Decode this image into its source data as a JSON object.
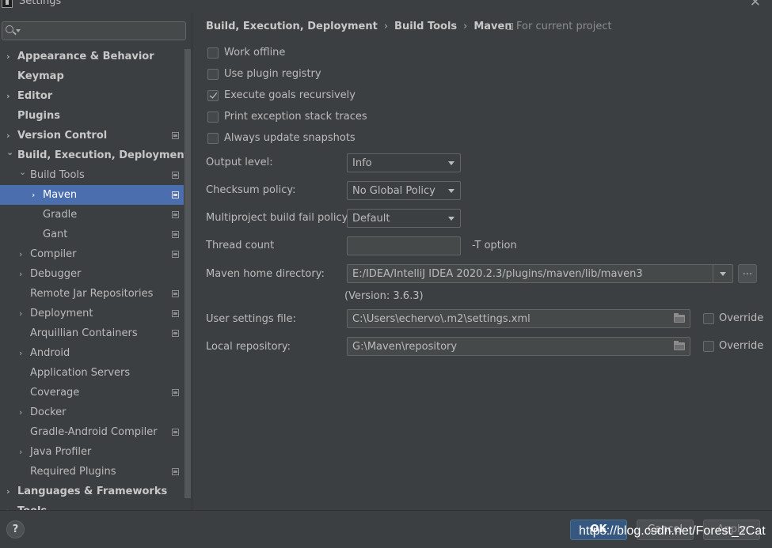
{
  "window": {
    "title": "Settings"
  },
  "sidebar": {
    "search": {
      "value": ""
    },
    "items": [
      {
        "label": "Appearance & Behavior",
        "expandable": true,
        "bold": true,
        "level": 0,
        "project": false
      },
      {
        "label": "Keymap",
        "expandable": false,
        "bold": true,
        "level": 0,
        "project": false
      },
      {
        "label": "Editor",
        "expandable": true,
        "bold": true,
        "level": 0,
        "project": false
      },
      {
        "label": "Plugins",
        "expandable": false,
        "bold": true,
        "level": 0,
        "project": false
      },
      {
        "label": "Version Control",
        "expandable": true,
        "bold": true,
        "level": 0,
        "project": true
      },
      {
        "label": "Build, Execution, Deployment",
        "expandable": true,
        "expanded": true,
        "bold": true,
        "level": 0,
        "project": false
      },
      {
        "label": "Build Tools",
        "expandable": true,
        "expanded": true,
        "bold": false,
        "level": 1,
        "project": true
      },
      {
        "label": "Maven",
        "expandable": true,
        "bold": false,
        "level": 2,
        "project": true,
        "selected": true
      },
      {
        "label": "Gradle",
        "expandable": false,
        "bold": false,
        "level": 2,
        "project": true
      },
      {
        "label": "Gant",
        "expandable": false,
        "bold": false,
        "level": 2,
        "project": true
      },
      {
        "label": "Compiler",
        "expandable": true,
        "bold": false,
        "level": 1,
        "project": true
      },
      {
        "label": "Debugger",
        "expandable": true,
        "bold": false,
        "level": 1,
        "project": false
      },
      {
        "label": "Remote Jar Repositories",
        "expandable": false,
        "bold": false,
        "level": 1,
        "project": true
      },
      {
        "label": "Deployment",
        "expandable": true,
        "bold": false,
        "level": 1,
        "project": true
      },
      {
        "label": "Arquillian Containers",
        "expandable": false,
        "bold": false,
        "level": 1,
        "project": true
      },
      {
        "label": "Android",
        "expandable": true,
        "bold": false,
        "level": 1,
        "project": false
      },
      {
        "label": "Application Servers",
        "expandable": false,
        "bold": false,
        "level": 1,
        "project": false
      },
      {
        "label": "Coverage",
        "expandable": false,
        "bold": false,
        "level": 1,
        "project": true
      },
      {
        "label": "Docker",
        "expandable": true,
        "bold": false,
        "level": 1,
        "project": false
      },
      {
        "label": "Gradle-Android Compiler",
        "expandable": false,
        "bold": false,
        "level": 1,
        "project": true
      },
      {
        "label": "Java Profiler",
        "expandable": true,
        "bold": false,
        "level": 1,
        "project": false
      },
      {
        "label": "Required Plugins",
        "expandable": false,
        "bold": false,
        "level": 1,
        "project": true
      },
      {
        "label": "Languages & Frameworks",
        "expandable": true,
        "bold": true,
        "level": 0,
        "project": false
      },
      {
        "label": "Tools",
        "expandable": true,
        "bold": true,
        "level": 0,
        "project": false
      }
    ]
  },
  "breadcrumb": {
    "part1": "Build, Execution, Deployment",
    "part2": "Build Tools",
    "part3": "Maven",
    "scope": "For current project"
  },
  "options": {
    "work_offline": {
      "label": "Work offline",
      "checked": false
    },
    "use_plugin_registry": {
      "label": "Use plugin registry",
      "checked": false
    },
    "execute_goals_recursively": {
      "label": "Execute goals recursively",
      "checked": true
    },
    "print_exception_stack_traces": {
      "label": "Print exception stack traces",
      "checked": false
    },
    "always_update_snapshots": {
      "label": "Always update snapshots",
      "checked": false
    }
  },
  "fields": {
    "output_level": {
      "label": "Output level:",
      "value": "Info"
    },
    "checksum_policy": {
      "label": "Checksum policy:",
      "value": "No Global Policy"
    },
    "multiproject_fail_policy": {
      "label": "Multiproject build fail policy:",
      "value": "Default"
    },
    "thread_count": {
      "label": "Thread count",
      "value": "",
      "suffix": "-T option"
    },
    "maven_home": {
      "label": "Maven home directory:",
      "value": "E:/IDEA/IntelliJ IDEA 2020.2.3/plugins/maven/lib/maven3",
      "browse": "...",
      "version": "(Version: 3.6.3)"
    },
    "user_settings": {
      "label": "User settings file:",
      "value": "C:\\Users\\echervo\\.m2\\settings.xml",
      "override_label": "Override",
      "override": false
    },
    "local_repository": {
      "label": "Local repository:",
      "value": "G:\\Maven\\repository",
      "override_label": "Override",
      "override": false
    }
  },
  "footer": {
    "help": "?",
    "ok": "OK",
    "cancel": "Cancel",
    "apply": "Apply",
    "watermark": "https://blog.csdn.net/Forest_2Cat"
  }
}
